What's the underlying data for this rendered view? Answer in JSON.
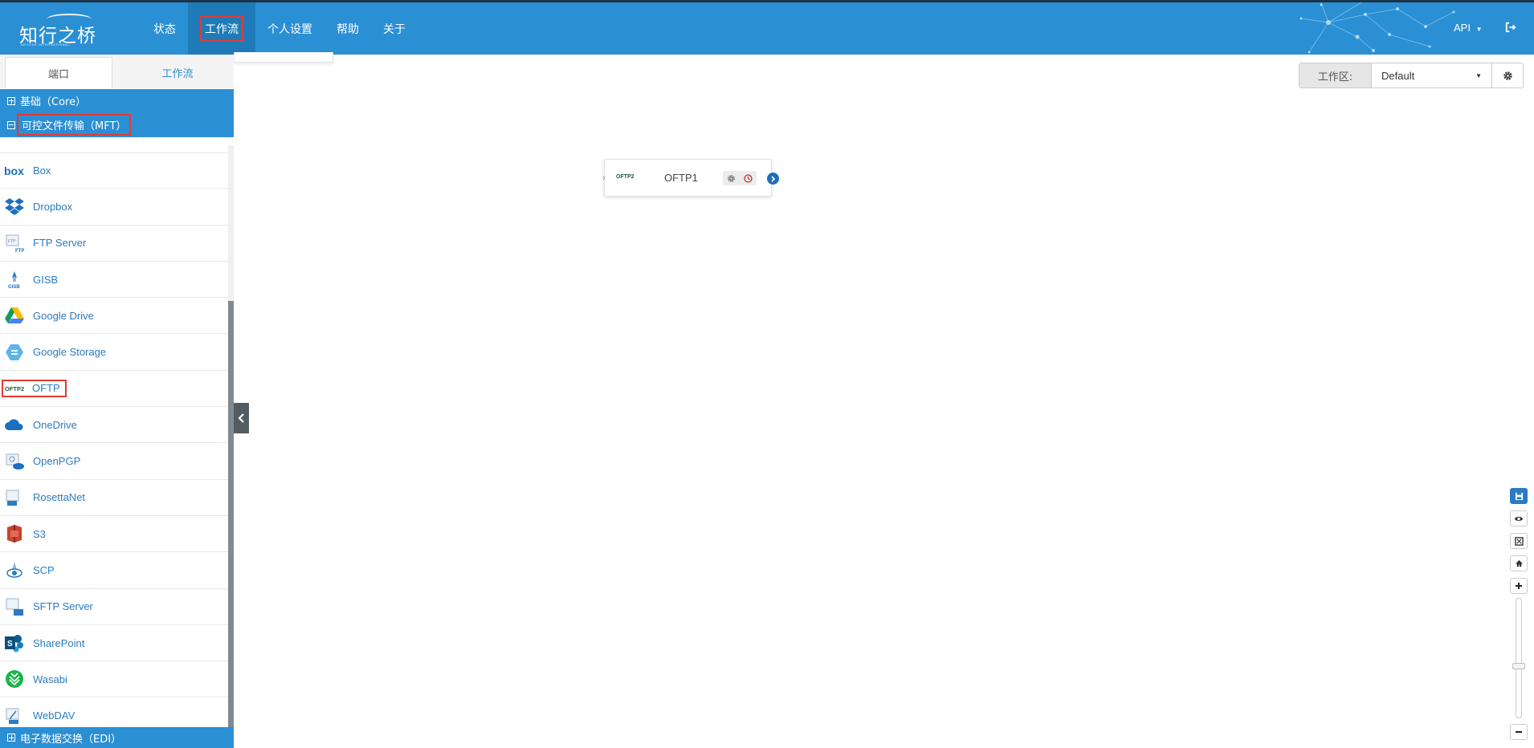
{
  "brand": {
    "logo_text": "知行之桥",
    "logo_sub": "ARCESB INTERNATIONAL"
  },
  "nav": {
    "items": [
      {
        "label": "状态"
      },
      {
        "label": "工作流"
      },
      {
        "label": "个人设置"
      },
      {
        "label": "帮助"
      },
      {
        "label": "关于"
      }
    ],
    "api_label": "API"
  },
  "sidebar": {
    "tabs": [
      {
        "label": "端口"
      },
      {
        "label": "工作流"
      }
    ],
    "categories": {
      "core": "基础（Core）",
      "mft": "可控文件传输（MFT）",
      "edi": "电子数据交换（EDI）"
    },
    "items": [
      {
        "label": "Box"
      },
      {
        "label": "Dropbox"
      },
      {
        "label": "FTP Server"
      },
      {
        "label": "GISB"
      },
      {
        "label": "Google Drive"
      },
      {
        "label": "Google Storage"
      },
      {
        "label": "OFTP"
      },
      {
        "label": "OneDrive"
      },
      {
        "label": "OpenPGP"
      },
      {
        "label": "RosettaNet"
      },
      {
        "label": "S3"
      },
      {
        "label": "SCP"
      },
      {
        "label": "SFTP Server"
      },
      {
        "label": "SharePoint"
      },
      {
        "label": "Wasabi"
      },
      {
        "label": "WebDAV"
      }
    ]
  },
  "workspace": {
    "label": "工作区:",
    "selected": "Default"
  },
  "canvas": {
    "node": {
      "title": "OFTP1",
      "logo": "OFTP2"
    }
  },
  "colors": {
    "primary": "#2b8fd3",
    "highlight": "#e53935"
  }
}
